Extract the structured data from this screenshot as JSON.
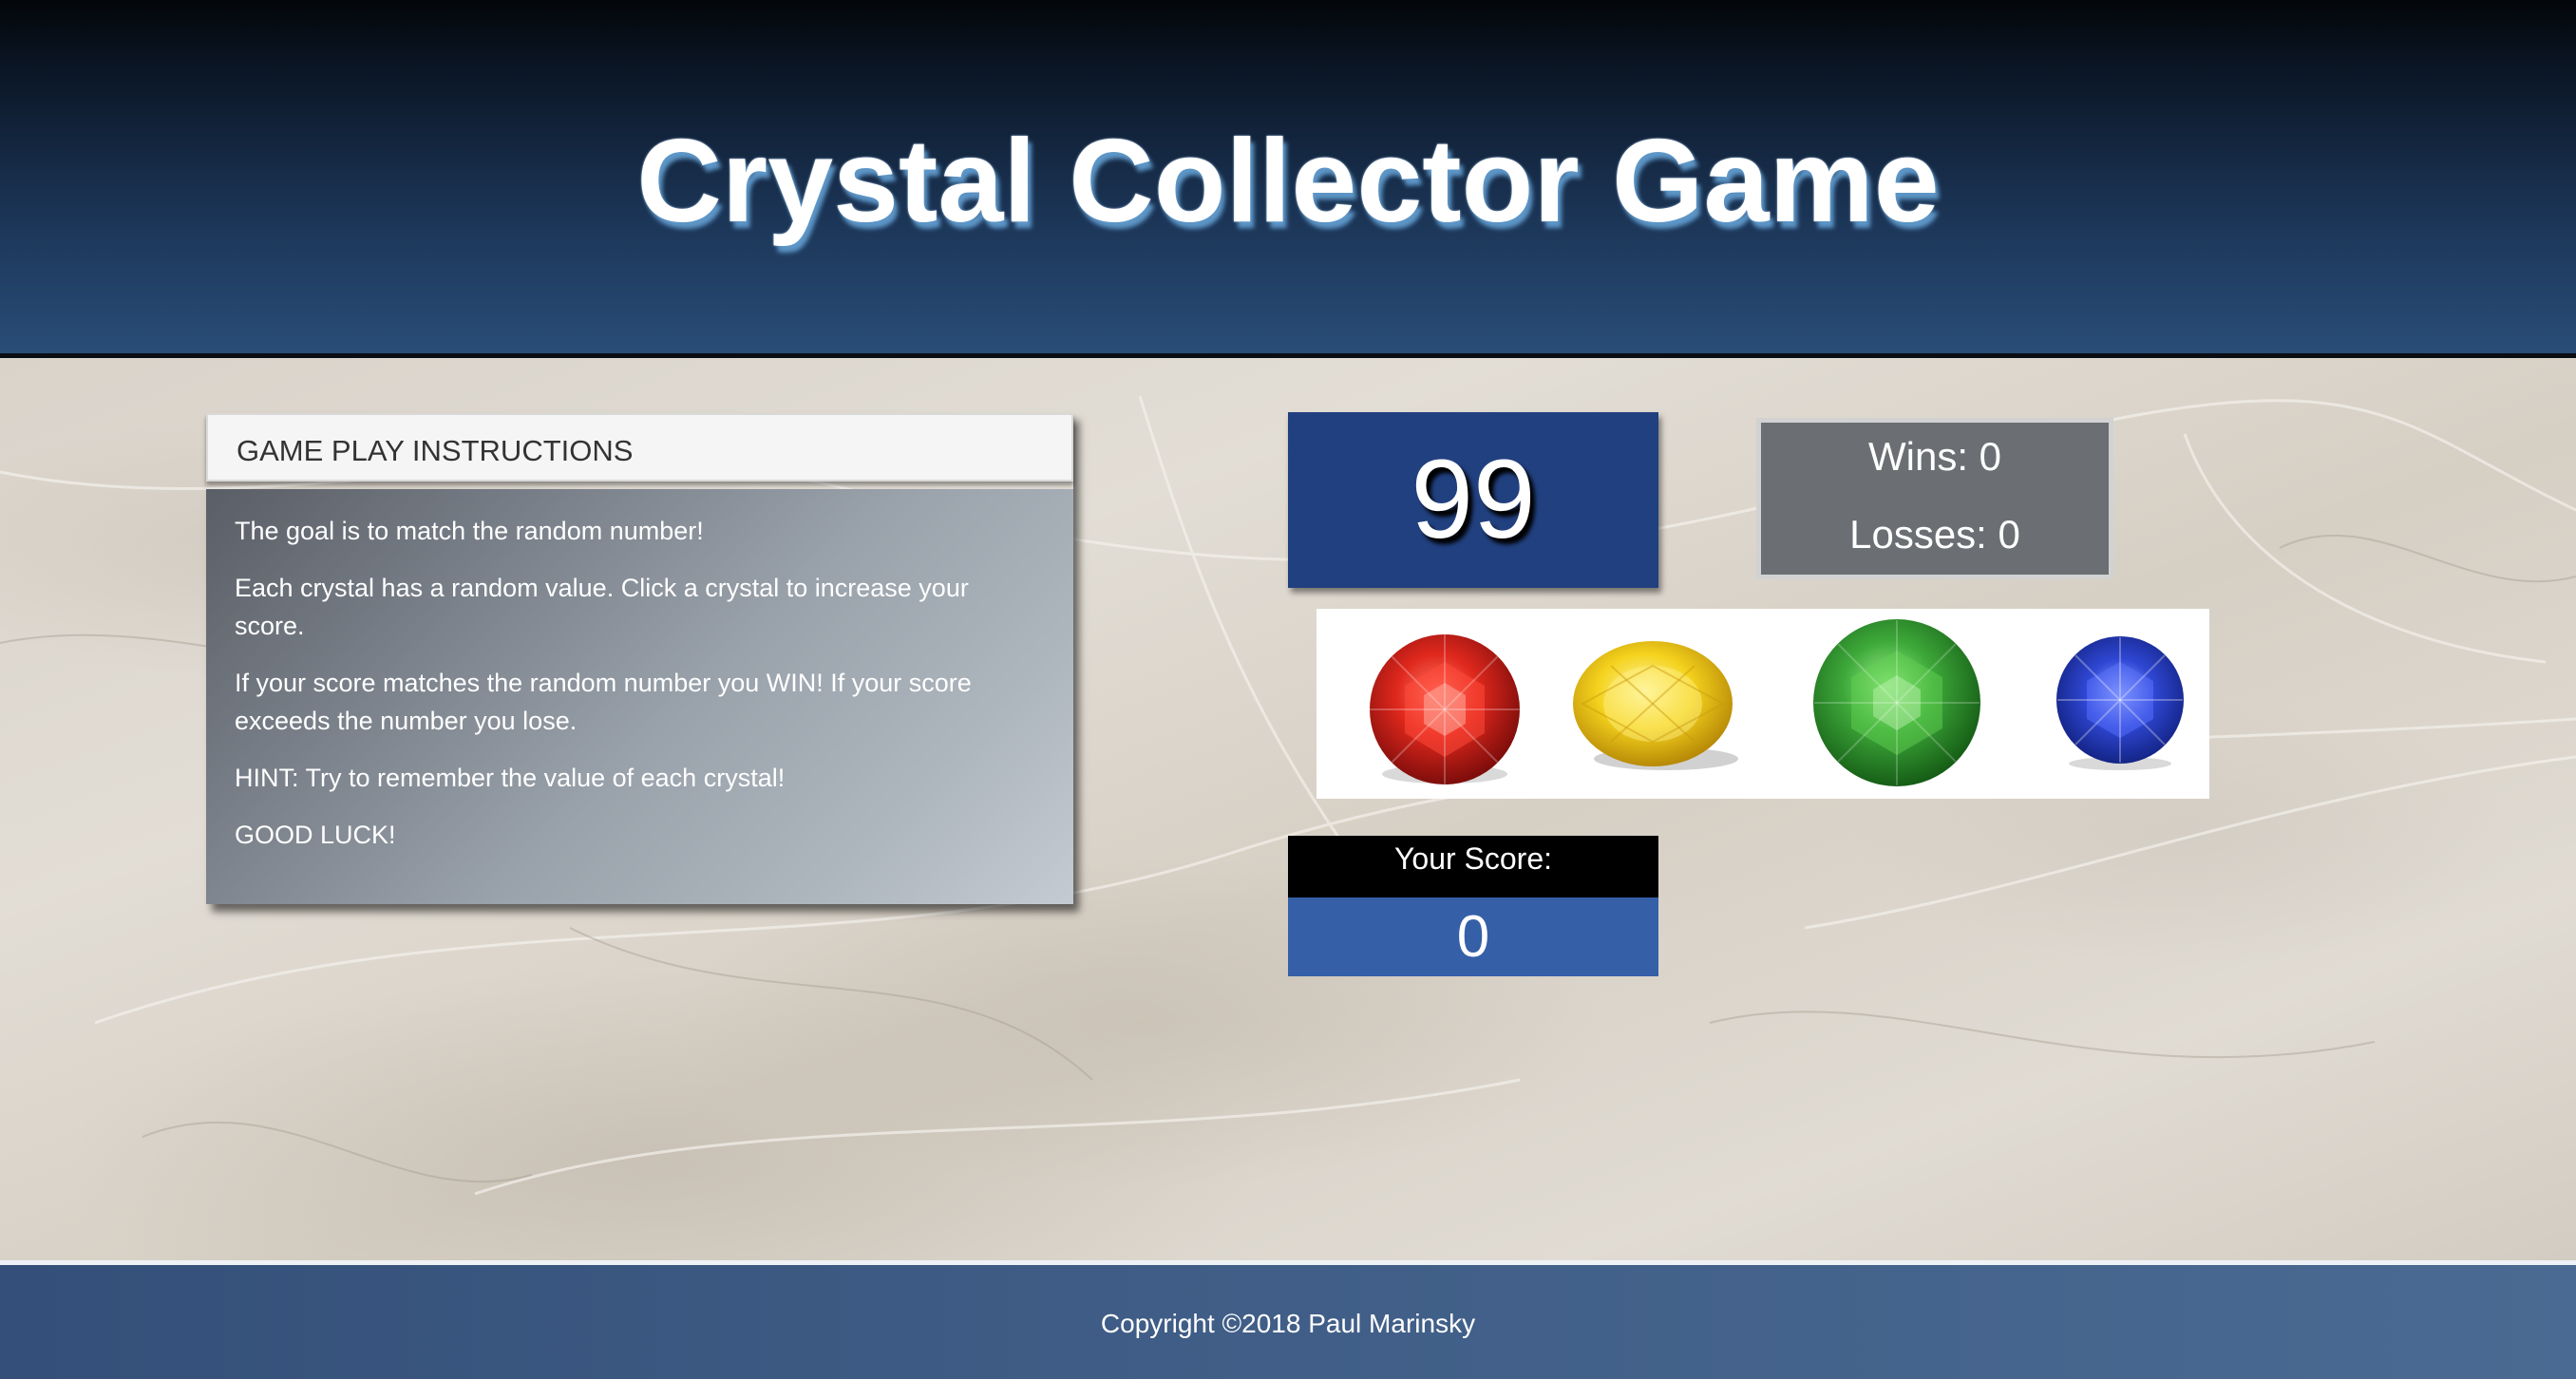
{
  "header": {
    "title": "Crystal Collector Game"
  },
  "instructions": {
    "heading": "GAME PLAY INSTRUCTIONS",
    "paragraphs": [
      "The goal is to match the random number!",
      "Each crystal has a random value. Click a crystal to increase your score.",
      "If your score matches the random number you WIN! If your score exceeds the number you lose.",
      "HINT: Try to remember the value of each crystal!",
      "GOOD LUCK!"
    ]
  },
  "game": {
    "target_number": "99",
    "wins_text": "Wins: 0",
    "losses_text": "Losses: 0",
    "score_label": "Your Score:",
    "score_value": "0"
  },
  "crystals": [
    {
      "name": "red-crystal",
      "color": "#d42a20"
    },
    {
      "name": "yellow-crystal",
      "color": "#f2d21e"
    },
    {
      "name": "green-crystal",
      "color": "#2f9c2b"
    },
    {
      "name": "blue-crystal",
      "color": "#2a3fc9"
    }
  ],
  "footer": {
    "copyright": "Copyright ©2018 Paul Marinsky"
  },
  "colors": {
    "target_bg": "#21407f",
    "stats_bg": "#6b6f73",
    "score_bg": "#3560a8"
  }
}
